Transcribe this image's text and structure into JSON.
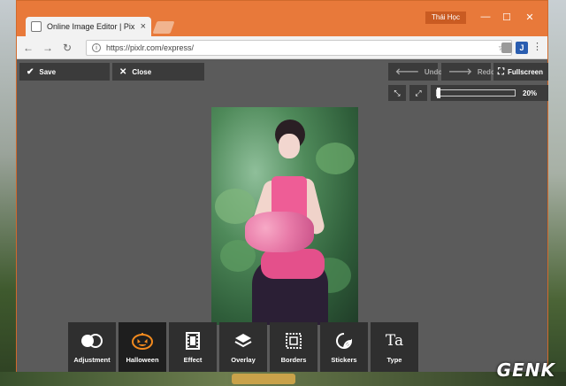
{
  "browser": {
    "tab_title": "Online Image Editor | Pix",
    "tab_close": "×",
    "user_name": "Thái Học",
    "url": "https://pixlr.com/express/",
    "ext_label": "J",
    "window_controls": {
      "minimize": "—",
      "maximize": "☐",
      "close": "✕"
    }
  },
  "editor": {
    "top_left": [
      {
        "label": "Save",
        "icon": "check-icon",
        "glyph": "✔"
      },
      {
        "label": "Close",
        "icon": "close-icon",
        "glyph": "✕"
      }
    ],
    "top_right": [
      {
        "label": "Undo",
        "icon": "arrow-left-icon",
        "glyph": "🡐"
      },
      {
        "label": "Redo",
        "icon": "arrow-right-icon",
        "glyph": "🡒"
      },
      {
        "label": "Fullscreen",
        "icon": "fullscreen-icon",
        "glyph": "⛶"
      }
    ],
    "zoom": {
      "value_label": "20%",
      "level": 0.2
    }
  },
  "tools": [
    {
      "label": "Adjustment",
      "icon": "adjustment-icon",
      "glyph": "⬤⬤"
    },
    {
      "label": "Halloween",
      "icon": "pumpkin-icon",
      "glyph": "🎃"
    },
    {
      "label": "Effect",
      "icon": "film-icon",
      "glyph": "🎞"
    },
    {
      "label": "Overlay",
      "icon": "layers-icon",
      "glyph": "◈"
    },
    {
      "label": "Borders",
      "icon": "border-icon",
      "glyph": "▣"
    },
    {
      "label": "Stickers",
      "icon": "sticker-icon",
      "glyph": "◔"
    },
    {
      "label": "Type",
      "icon": "type-icon",
      "glyph": "Ta"
    }
  ],
  "watermark": "GENK"
}
